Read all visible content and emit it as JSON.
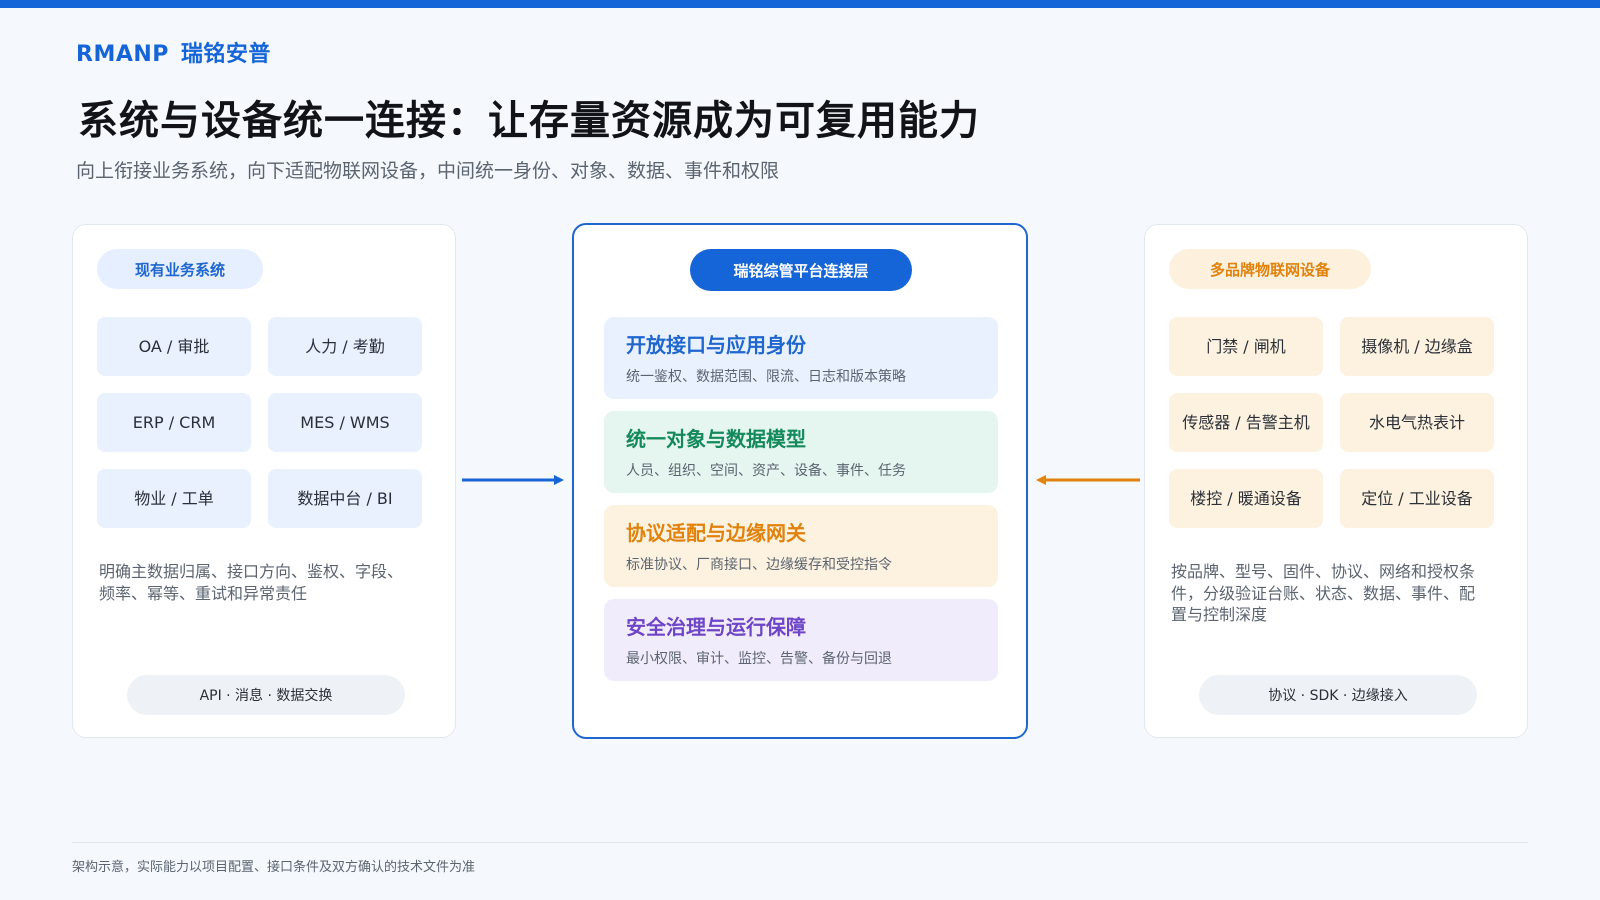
{
  "colors": {
    "accent_blue": "#1565d8",
    "accent_orange": "#e0820c",
    "green": "#148a5c",
    "purple": "#6e45c7"
  },
  "brand": {
    "name_en": "RMANP",
    "name_cn": "瑞铭安普"
  },
  "title": "系统与设备统一连接：让存量资源成为可复用能力",
  "subtitle": "向上衔接业务系统，向下适配物联网设备，中间统一身份、对象、数据、事件和权限",
  "left_panel": {
    "header": "现有业务系统",
    "tiles": [
      "OA / 审批",
      "人力 / 考勤",
      "ERP / CRM",
      "MES / WMS",
      "物业 / 工单",
      "数据中台 / BI"
    ],
    "description": "明确主数据归属、接口方向、鉴权、字段、频率、幂等、重试和异常责任",
    "footer": "API · 消息 · 数据交换"
  },
  "center_panel": {
    "header": "瑞铭综管平台连接层",
    "layers": [
      {
        "title": "开放接口与应用身份",
        "desc": "统一鉴权、数据范围、限流、日志和版本策略"
      },
      {
        "title": "统一对象与数据模型",
        "desc": "人员、组织、空间、资产、设备、事件、任务"
      },
      {
        "title": "协议适配与边缘网关",
        "desc": "标准协议、厂商接口、边缘缓存和受控指令"
      },
      {
        "title": "安全治理与运行保障",
        "desc": "最小权限、审计、监控、告警、备份与回退"
      }
    ]
  },
  "right_panel": {
    "header": "多品牌物联网设备",
    "tiles": [
      "门禁 / 闸机",
      "摄像机 / 边缘盒",
      "传感器 / 告警主机",
      "水电气热表计",
      "楼控 / 暖通设备",
      "定位 / 工业设备"
    ],
    "description": "按品牌、型号、固件、协议、网络和授权条件，分级验证台账、状态、数据、事件、配置与控制深度",
    "footer": "协议 · SDK · 边缘接入"
  },
  "footnote": "架构示意，实际能力以项目配置、接口条件及双方确认的技术文件为准"
}
